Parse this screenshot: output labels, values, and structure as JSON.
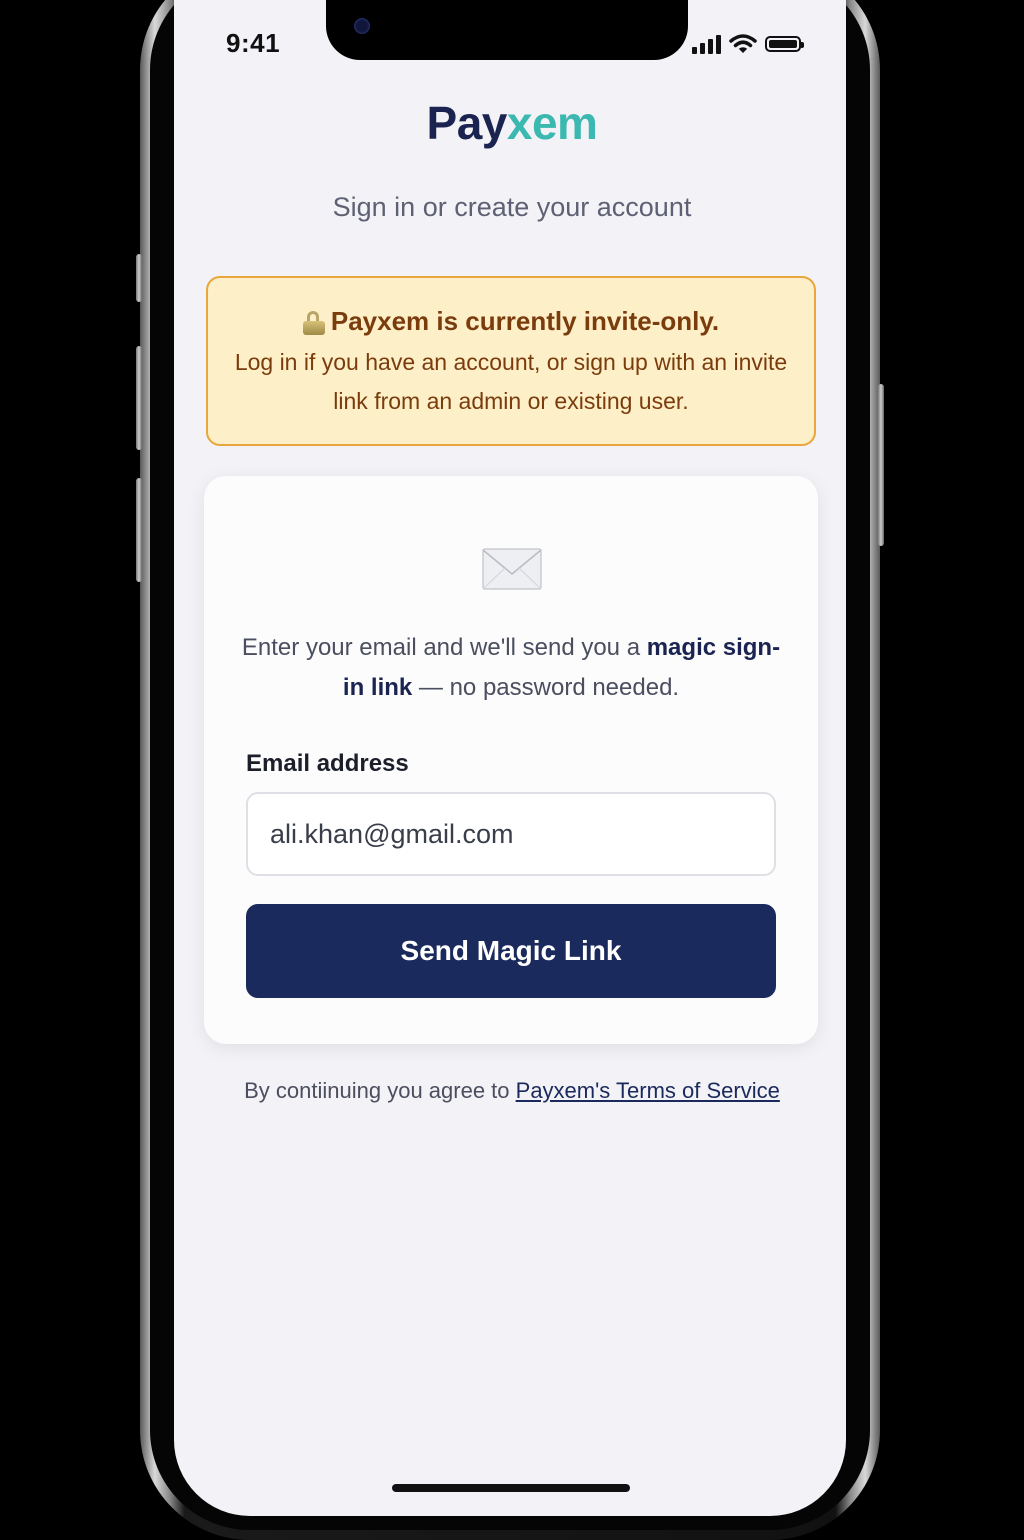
{
  "status_bar": {
    "time": "9:41"
  },
  "header": {
    "logo_part1": "Pay",
    "logo_part2": "xem",
    "subtitle": "Sign in or create your account"
  },
  "notice": {
    "icon": "lock-icon",
    "title": "Payxem is currently invite-only.",
    "body": "Log in if you have an account, or sign up with an invite link from an admin or existing user."
  },
  "card": {
    "icon": "envelope-icon",
    "intro_prefix": "Enter your email and we'll send you a ",
    "intro_emphasis": "magic sign-in link",
    "intro_suffix": " — no password needed.",
    "email_label": "Email address",
    "email_value": "ali.khan@gmail.com",
    "button_label": "Send Magic Link"
  },
  "footer": {
    "terms_prefix": "By contiinuing you agree to ",
    "terms_link": "Payxem's Terms of Service"
  },
  "colors": {
    "brand_navy": "#1b2a5c",
    "brand_teal": "#3bb8b0",
    "notice_bg": "#fdefc7",
    "notice_border": "#e8a63c"
  }
}
